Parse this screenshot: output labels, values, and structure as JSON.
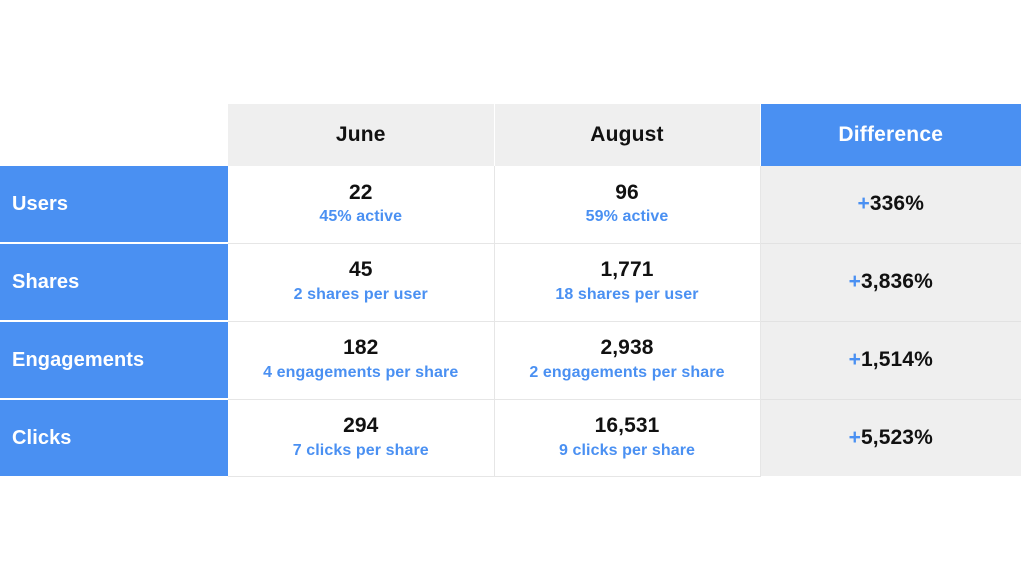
{
  "table": {
    "corner_label": "",
    "columns": [
      {
        "key": "label",
        "label": ""
      },
      {
        "key": "june",
        "label": "June"
      },
      {
        "key": "august",
        "label": "August"
      },
      {
        "key": "diff",
        "label": "Difference"
      }
    ],
    "rows": [
      {
        "label": "Users",
        "june": {
          "value": "22",
          "sub": "45% active"
        },
        "august": {
          "value": "96",
          "sub": "59% active"
        },
        "diff": {
          "sign": "+",
          "value": "336%"
        }
      },
      {
        "label": "Shares",
        "june": {
          "value": "45",
          "sub": "2 shares per user"
        },
        "august": {
          "value": "1,771",
          "sub": "18 shares per user"
        },
        "diff": {
          "sign": "+",
          "value": "3,836%"
        }
      },
      {
        "label": "Engagements",
        "june": {
          "value": "182",
          "sub": "4 engagements per share"
        },
        "august": {
          "value": "2,938",
          "sub": "2 engagements per share"
        },
        "diff": {
          "sign": "+",
          "value": "1,514%"
        }
      },
      {
        "label": "Clicks",
        "june": {
          "value": "294",
          "sub": "7 clicks per share"
        },
        "august": {
          "value": "16,531",
          "sub": "9 clicks per share"
        },
        "diff": {
          "sign": "+",
          "value": "5,523%"
        }
      }
    ]
  },
  "colors": {
    "accent_blue": "#4a90f2",
    "header_gray": "#efefef",
    "diff_cell_gray": "#efefef",
    "text_dark": "#111111",
    "page_background": "#ffffff"
  }
}
